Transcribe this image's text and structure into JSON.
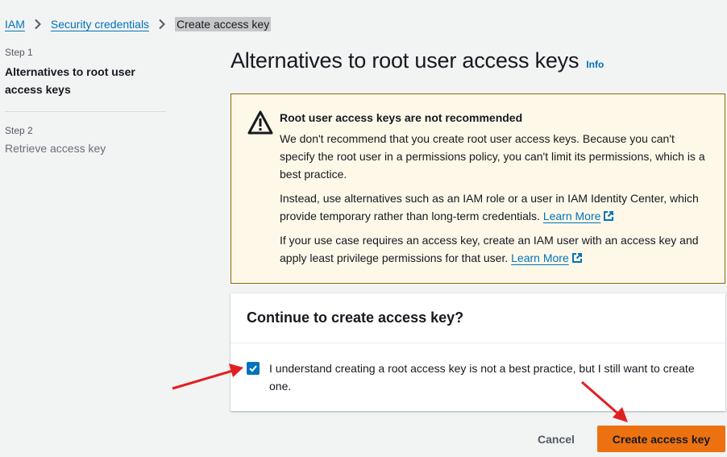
{
  "breadcrumb": {
    "items": [
      {
        "label": "IAM"
      },
      {
        "label": "Security credentials"
      },
      {
        "label": "Create access key"
      }
    ]
  },
  "steps": [
    {
      "label": "Step 1",
      "title": "Alternatives to root user access keys",
      "active": true
    },
    {
      "label": "Step 2",
      "title": "Retrieve access key",
      "active": false
    }
  ],
  "page": {
    "title": "Alternatives to root user access keys",
    "info_label": "Info"
  },
  "alert": {
    "type": "warning",
    "title": "Root user access keys are not recommended",
    "p1": "We don't recommend that you create root user access keys. Because you can't specify the root user in a permissions policy, you can't limit its permissions, which is a best practice.",
    "p2_text": "Instead, use alternatives such as an IAM role or a user in IAM Identity Center, which provide temporary rather than long-term credentials.",
    "p2_link": "Learn More",
    "p3_text": "If your use case requires an access key, create an IAM user with an access key and apply least privilege permissions for that user.",
    "p3_link": "Learn More"
  },
  "confirm": {
    "title": "Continue to create access key?",
    "checkbox_label": "I understand creating a root access key is not a best practice, but I still want to create one.",
    "checked": true
  },
  "actions": {
    "cancel_label": "Cancel",
    "primary_label": "Create access key"
  },
  "colors": {
    "link": "#0073bb",
    "primary": "#ec7211",
    "warning_bg": "#fef8e9",
    "warning_border": "#906806",
    "annotation": "#e02020"
  }
}
